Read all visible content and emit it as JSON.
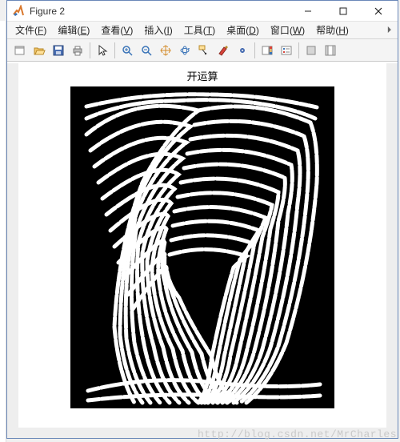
{
  "window": {
    "title": "Figure 2"
  },
  "menu": {
    "file": {
      "label": "文件",
      "mn": "F"
    },
    "edit": {
      "label": "编辑",
      "mn": "E"
    },
    "view": {
      "label": "查看",
      "mn": "V"
    },
    "insert": {
      "label": "插入",
      "mn": "I"
    },
    "tools": {
      "label": "工具",
      "mn": "T"
    },
    "desktop": {
      "label": "桌面",
      "mn": "D"
    },
    "window": {
      "label": "窗口",
      "mn": "W"
    },
    "help": {
      "label": "帮助",
      "mn": "H"
    }
  },
  "figure": {
    "title": "开运算"
  },
  "watermark": "http://blog.csdn.net/MrCharles",
  "icons": {
    "app": "matlab-icon",
    "minimize": "minimize-icon",
    "maximize": "maximize-icon",
    "close": "close-icon",
    "new": "new-figure-icon",
    "open": "open-icon",
    "save": "save-icon",
    "print": "print-icon",
    "pointer": "pointer-icon",
    "zoomin": "zoom-in-icon",
    "zoomout": "zoom-out-icon",
    "pan": "pan-icon",
    "rotate": "rotate3d-icon",
    "datacursor": "data-cursor-icon",
    "brush": "brush-icon",
    "link": "link-plot-icon",
    "colorbar": "colorbar-icon",
    "legend": "legend-icon",
    "hideplot": "hide-plot-tools-icon",
    "showplot": "show-plot-tools-icon"
  }
}
